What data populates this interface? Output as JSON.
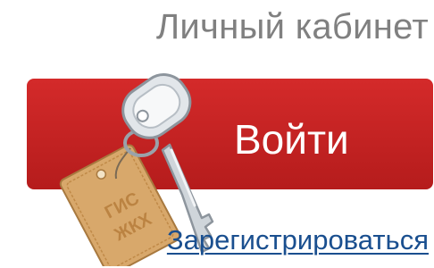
{
  "header": {
    "title": "Личный кабинет"
  },
  "login": {
    "button_label": "Войти",
    "button_color": "#c62525"
  },
  "icons": {
    "keys": "keys-icon",
    "tag_text": "ГИС ЖКХ"
  },
  "register": {
    "link_label": "Зарегистрироваться",
    "link_color": "#1a4f8f"
  }
}
